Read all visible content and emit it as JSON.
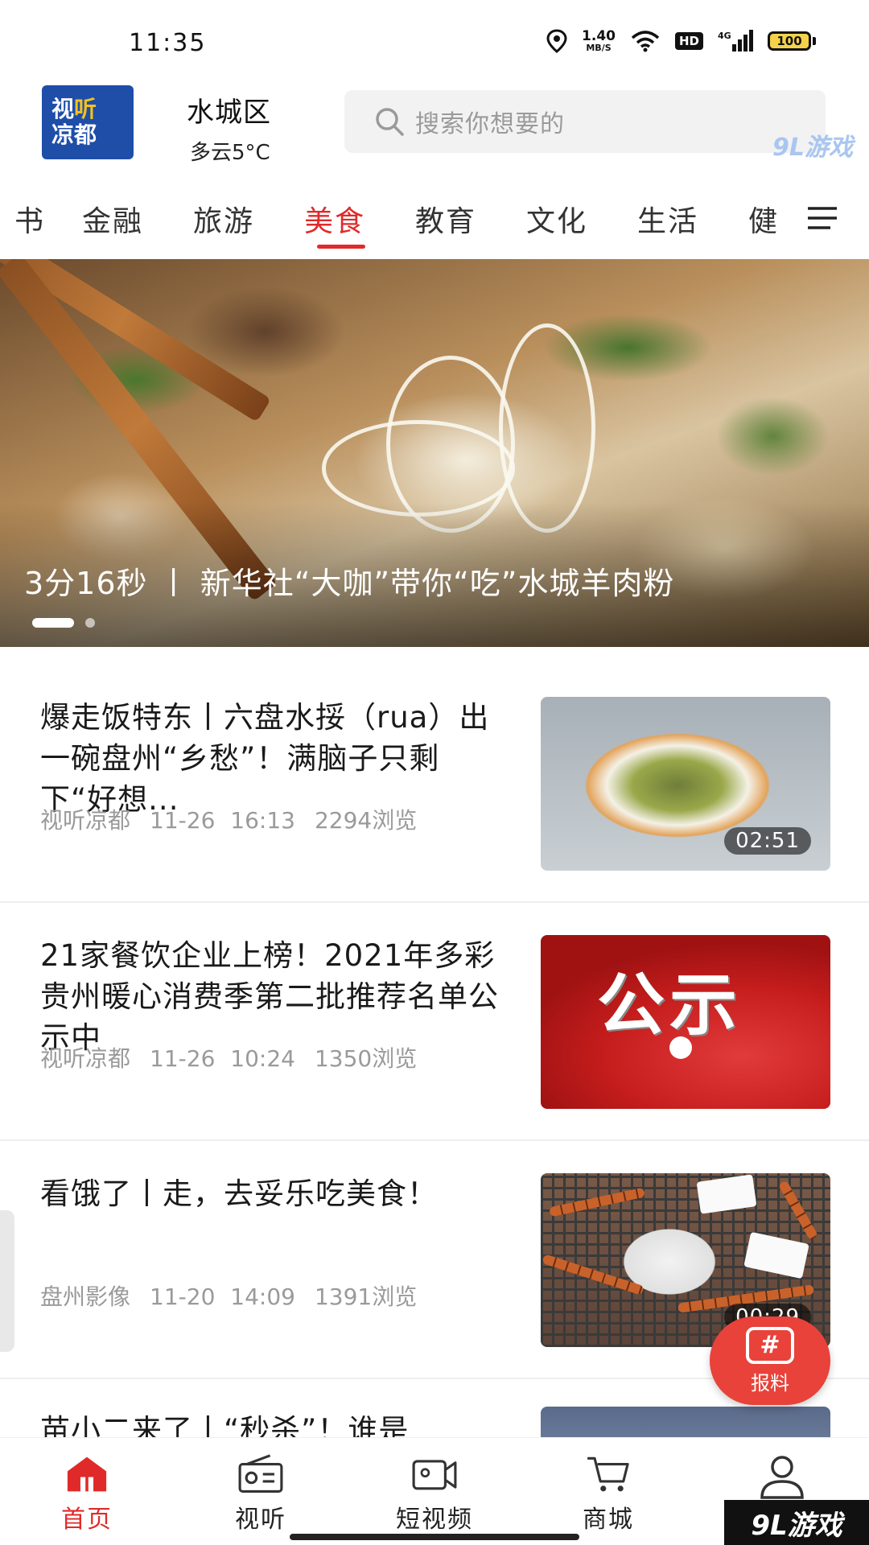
{
  "status_bar": {
    "time": "11:35",
    "net_speed_value": "1.40",
    "net_speed_unit": "MB/S",
    "hd_badge": "HD",
    "signal_type": "4G",
    "battery": "100"
  },
  "header": {
    "logo_line1_a": "视",
    "logo_line1_b": "听",
    "logo_line2": "凉都",
    "location_name": "水城区",
    "weather": "多云5°C",
    "search_placeholder": "搜索你想要的",
    "watermark": "9L游戏"
  },
  "categories": {
    "items": [
      "书",
      "金融",
      "旅游",
      "美食",
      "教育",
      "文化",
      "生活",
      "健"
    ],
    "active": "美食"
  },
  "banner": {
    "caption": "3分16秒 丨 新华社“大咖”带你“吃”水城羊肉粉"
  },
  "news": [
    {
      "title": "爆走饭特东丨六盘水挼（rua）出一碗盘州“乡愁”！满脑子只剩下“好想...",
      "source": "视听凉都",
      "time": "11-26 16:13",
      "views": "2294浏览",
      "duration": "02:51"
    },
    {
      "title": "21家餐饮企业上榜！2021年多彩贵州暖心消费季第二批推荐名单公示中",
      "source": "视听凉都",
      "time": "11-26 10:24",
      "views": "1350浏览",
      "thumb_text": "公示"
    },
    {
      "title": "看饿了丨走，去妥乐吃美食！",
      "source": "盘州影像",
      "time": "11-20 14:09",
      "views": "1391浏览",
      "duration": "00:29"
    },
    {
      "title": "苗小二来了丨“秒杀”！谁是"
    }
  ],
  "report_button": {
    "icon": "#",
    "label": "报料"
  },
  "bottom_nav": {
    "items": [
      {
        "label": "首页",
        "icon": "home-icon"
      },
      {
        "label": "视听",
        "icon": "radio-icon"
      },
      {
        "label": "短视频",
        "icon": "video-camera-icon"
      },
      {
        "label": "商城",
        "icon": "cart-icon"
      },
      {
        "label": "",
        "icon": "user-icon"
      }
    ],
    "active": "首页"
  },
  "corner_brand": "9L游戏",
  "colors": {
    "accent": "#e02a2a",
    "logo_blue": "#1e4ea8",
    "meta_gray": "#9a9a9a"
  }
}
